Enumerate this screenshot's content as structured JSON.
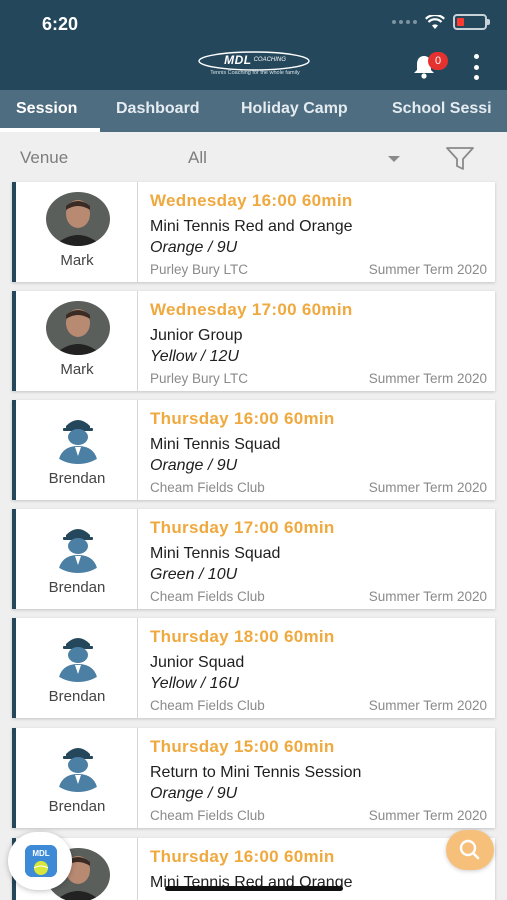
{
  "status_bar": {
    "time": "6:20"
  },
  "header": {
    "logo_text": "MDL",
    "logo_sub": "COACHING",
    "logo_tagline": "Tennis Coaching for the whole family",
    "notification_count": "0"
  },
  "tabs": [
    {
      "label": "Session",
      "active": true
    },
    {
      "label": "Dashboard",
      "active": false
    },
    {
      "label": "Holiday Camp",
      "active": false
    },
    {
      "label": "School Sessi",
      "active": false
    }
  ],
  "filter": {
    "label": "Venue",
    "value": "All"
  },
  "sessions": [
    {
      "coach": "Mark",
      "avatar": "photo",
      "when": "Wednesday 16:00 60min",
      "group": "Mini Tennis Red and Orange",
      "level": "Orange / 9U",
      "venue": "Purley Bury LTC",
      "term": "Summer Term 2020"
    },
    {
      "coach": "Mark",
      "avatar": "photo",
      "when": "Wednesday 17:00 60min",
      "group": "Junior Group",
      "level": "Yellow / 12U",
      "venue": "Purley Bury LTC",
      "term": "Summer Term 2020"
    },
    {
      "coach": "Brendan",
      "avatar": "placeholder",
      "when": "Thursday 16:00 60min",
      "group": "Mini Tennis Squad",
      "level": "Orange / 9U",
      "venue": "Cheam Fields Club",
      "term": "Summer Term 2020"
    },
    {
      "coach": "Brendan",
      "avatar": "placeholder",
      "when": "Thursday 17:00 60min",
      "group": "Mini Tennis Squad",
      "level": "Green / 10U",
      "venue": "Cheam Fields Club",
      "term": "Summer Term 2020"
    },
    {
      "coach": "Brendan",
      "avatar": "placeholder",
      "when": "Thursday 18:00 60min",
      "group": "Junior Squad",
      "level": "Yellow / 16U",
      "venue": "Cheam Fields Club",
      "term": "Summer Term 2020"
    },
    {
      "coach": "Brendan",
      "avatar": "placeholder",
      "when": "Thursday 15:00 60min",
      "group": "Return to Mini Tennis Session",
      "level": "Orange / 9U",
      "venue": "Cheam Fields Club",
      "term": "Summer Term 2020"
    },
    {
      "coach": "",
      "avatar": "photo",
      "when": "Thursday 16:00 60min",
      "group": "Mini Tennis Red and Orange",
      "level": "",
      "venue": "",
      "term": ""
    }
  ],
  "colors": {
    "header_bg": "#24475b",
    "tab_bg": "#4f6d80",
    "accent_orange": "#efa93e",
    "card_border": "#24475b"
  },
  "icons": [
    "signal-icon",
    "wifi-icon",
    "battery-icon",
    "bell-icon",
    "more-vertical-icon",
    "dropdown-caret-icon",
    "filter-icon",
    "search-icon",
    "app-icon",
    "coach-placeholder-icon"
  ]
}
